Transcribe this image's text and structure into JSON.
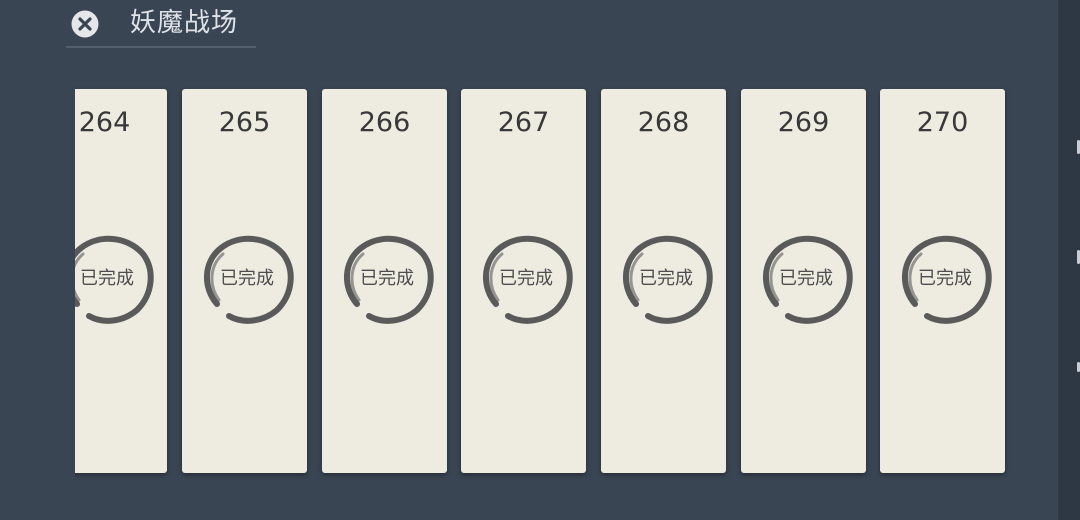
{
  "header": {
    "title": "妖魔战场",
    "close_icon": "close-circle-icon"
  },
  "stages": [
    {
      "level": "264",
      "status": "已完成"
    },
    {
      "level": "265",
      "status": "已完成"
    },
    {
      "level": "266",
      "status": "已完成"
    },
    {
      "level": "267",
      "status": "已完成"
    },
    {
      "level": "268",
      "status": "已完成"
    },
    {
      "level": "269",
      "status": "已完成"
    },
    {
      "level": "270",
      "status": "已完成"
    }
  ],
  "colors": {
    "background": "#3a4553",
    "card": "#eeebe1",
    "ink": "#4e4e4e"
  }
}
